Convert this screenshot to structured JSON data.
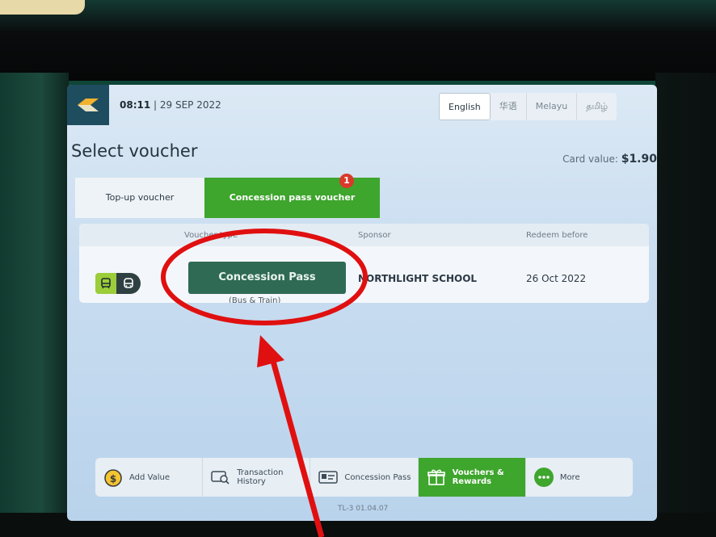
{
  "header": {
    "time": "08:11",
    "date": "| 29 SEP 2022",
    "languages": [
      "English",
      "华语",
      "Melayu",
      "தமிழ்"
    ],
    "active_language": "English"
  },
  "page": {
    "title": "Select voucher",
    "card_value_label": "Card value:",
    "card_value": "$1.90"
  },
  "tabs": [
    {
      "label": "Top-up voucher"
    },
    {
      "label": "Concession pass voucher",
      "badge": "1"
    }
  ],
  "table": {
    "columns": [
      "Voucher type",
      "Sponsor",
      "Redeem before"
    ],
    "row": {
      "voucher_button": "Concession Pass",
      "voucher_sub": "(Bus & Train)",
      "sponsor": "NORTHLIGHT SCHOOL",
      "redeem_before": "26 Oct 2022"
    }
  },
  "footer": {
    "items": [
      {
        "label": "Add Value",
        "icon": "dollar-coin-icon"
      },
      {
        "label": "Transaction History",
        "icon": "card-search-icon"
      },
      {
        "label": "Concession Pass",
        "icon": "id-card-icon"
      },
      {
        "label": "Vouchers & Rewards",
        "icon": "gift-icon"
      },
      {
        "label": "More",
        "icon": "more-dots-icon"
      }
    ],
    "version": "TL-3 01.04.07"
  },
  "colors": {
    "accent_green": "#3ea52d",
    "annotation_red": "#e01010",
    "button_dark_green": "#2f6a55"
  }
}
